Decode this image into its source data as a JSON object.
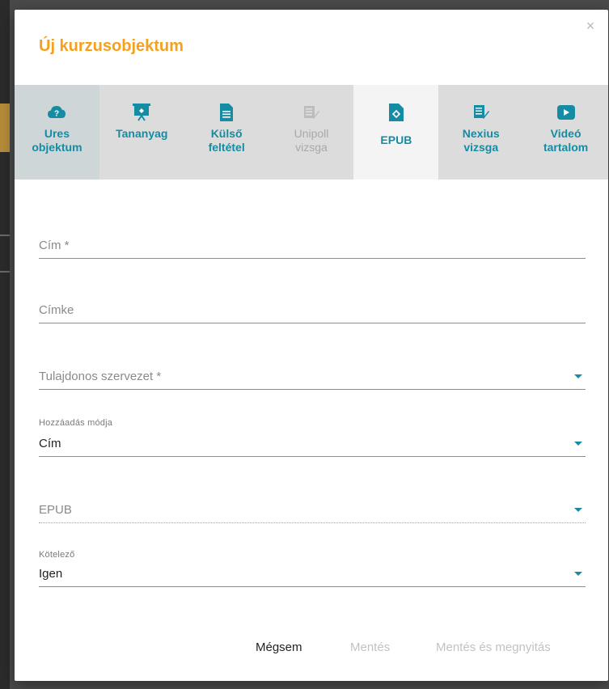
{
  "dialog": {
    "title": "Új kurzusobjektum",
    "close_symbol": "×"
  },
  "tabs": [
    {
      "label": "Ures\nobjektum",
      "icon": "cloud-question-icon",
      "state": "normal"
    },
    {
      "label": "Tananyag",
      "icon": "presentation-board-icon",
      "state": "normal"
    },
    {
      "label": "Külső\nfeltétel",
      "icon": "document-icon",
      "state": "normal"
    },
    {
      "label": "Unipoll\nvizsga",
      "icon": "survey-pen-icon",
      "state": "disabled"
    },
    {
      "label": "EPUB",
      "icon": "epub-icon",
      "state": "active"
    },
    {
      "label": "Nexius\nvizsga",
      "icon": "exam-checklist-icon",
      "state": "normal"
    },
    {
      "label": "Videó\ntartalom",
      "icon": "play-video-icon",
      "state": "normal"
    }
  ],
  "form": {
    "title_field": {
      "placeholder": "Cím *"
    },
    "tag_field": {
      "placeholder": "Címke"
    },
    "owner_org": {
      "placeholder": "Tulajdonos szervezet *"
    },
    "add_mode": {
      "label": "Hozzáadás módja",
      "value": "Cím"
    },
    "epub": {
      "placeholder": "EPUB"
    },
    "mandatory": {
      "label": "Kötelező",
      "value": "Igen"
    }
  },
  "footer": {
    "cancel": "Mégsem",
    "save": "Mentés",
    "save_open": "Mentés és megnyitás"
  },
  "colors": {
    "accent_orange": "#f5a11e",
    "accent_teal": "#158ca3",
    "disabled": "#a9a9a9"
  }
}
